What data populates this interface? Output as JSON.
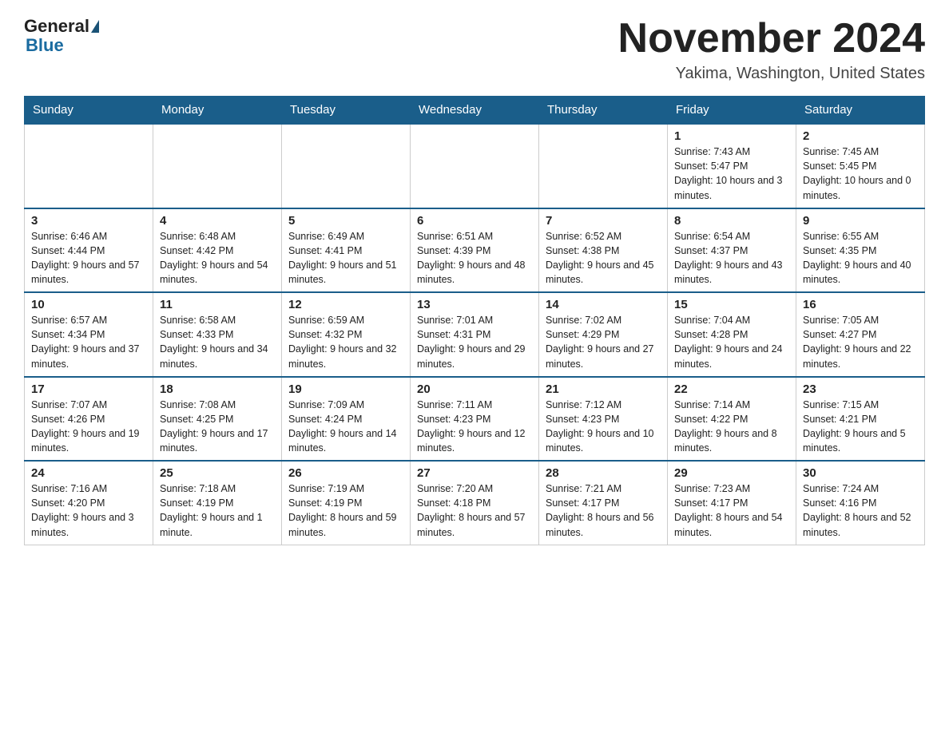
{
  "header": {
    "logo_general": "General",
    "logo_blue": "Blue",
    "month_title": "November 2024",
    "location": "Yakima, Washington, United States"
  },
  "weekdays": [
    "Sunday",
    "Monday",
    "Tuesday",
    "Wednesday",
    "Thursday",
    "Friday",
    "Saturday"
  ],
  "weeks": [
    [
      {
        "day": "",
        "info": "",
        "empty": true
      },
      {
        "day": "",
        "info": "",
        "empty": true
      },
      {
        "day": "",
        "info": "",
        "empty": true
      },
      {
        "day": "",
        "info": "",
        "empty": true
      },
      {
        "day": "",
        "info": "",
        "empty": true
      },
      {
        "day": "1",
        "info": "Sunrise: 7:43 AM\nSunset: 5:47 PM\nDaylight: 10 hours and 3 minutes."
      },
      {
        "day": "2",
        "info": "Sunrise: 7:45 AM\nSunset: 5:45 PM\nDaylight: 10 hours and 0 minutes."
      }
    ],
    [
      {
        "day": "3",
        "info": "Sunrise: 6:46 AM\nSunset: 4:44 PM\nDaylight: 9 hours and 57 minutes."
      },
      {
        "day": "4",
        "info": "Sunrise: 6:48 AM\nSunset: 4:42 PM\nDaylight: 9 hours and 54 minutes."
      },
      {
        "day": "5",
        "info": "Sunrise: 6:49 AM\nSunset: 4:41 PM\nDaylight: 9 hours and 51 minutes."
      },
      {
        "day": "6",
        "info": "Sunrise: 6:51 AM\nSunset: 4:39 PM\nDaylight: 9 hours and 48 minutes."
      },
      {
        "day": "7",
        "info": "Sunrise: 6:52 AM\nSunset: 4:38 PM\nDaylight: 9 hours and 45 minutes."
      },
      {
        "day": "8",
        "info": "Sunrise: 6:54 AM\nSunset: 4:37 PM\nDaylight: 9 hours and 43 minutes."
      },
      {
        "day": "9",
        "info": "Sunrise: 6:55 AM\nSunset: 4:35 PM\nDaylight: 9 hours and 40 minutes."
      }
    ],
    [
      {
        "day": "10",
        "info": "Sunrise: 6:57 AM\nSunset: 4:34 PM\nDaylight: 9 hours and 37 minutes."
      },
      {
        "day": "11",
        "info": "Sunrise: 6:58 AM\nSunset: 4:33 PM\nDaylight: 9 hours and 34 minutes."
      },
      {
        "day": "12",
        "info": "Sunrise: 6:59 AM\nSunset: 4:32 PM\nDaylight: 9 hours and 32 minutes."
      },
      {
        "day": "13",
        "info": "Sunrise: 7:01 AM\nSunset: 4:31 PM\nDaylight: 9 hours and 29 minutes."
      },
      {
        "day": "14",
        "info": "Sunrise: 7:02 AM\nSunset: 4:29 PM\nDaylight: 9 hours and 27 minutes."
      },
      {
        "day": "15",
        "info": "Sunrise: 7:04 AM\nSunset: 4:28 PM\nDaylight: 9 hours and 24 minutes."
      },
      {
        "day": "16",
        "info": "Sunrise: 7:05 AM\nSunset: 4:27 PM\nDaylight: 9 hours and 22 minutes."
      }
    ],
    [
      {
        "day": "17",
        "info": "Sunrise: 7:07 AM\nSunset: 4:26 PM\nDaylight: 9 hours and 19 minutes."
      },
      {
        "day": "18",
        "info": "Sunrise: 7:08 AM\nSunset: 4:25 PM\nDaylight: 9 hours and 17 minutes."
      },
      {
        "day": "19",
        "info": "Sunrise: 7:09 AM\nSunset: 4:24 PM\nDaylight: 9 hours and 14 minutes."
      },
      {
        "day": "20",
        "info": "Sunrise: 7:11 AM\nSunset: 4:23 PM\nDaylight: 9 hours and 12 minutes."
      },
      {
        "day": "21",
        "info": "Sunrise: 7:12 AM\nSunset: 4:23 PM\nDaylight: 9 hours and 10 minutes."
      },
      {
        "day": "22",
        "info": "Sunrise: 7:14 AM\nSunset: 4:22 PM\nDaylight: 9 hours and 8 minutes."
      },
      {
        "day": "23",
        "info": "Sunrise: 7:15 AM\nSunset: 4:21 PM\nDaylight: 9 hours and 5 minutes."
      }
    ],
    [
      {
        "day": "24",
        "info": "Sunrise: 7:16 AM\nSunset: 4:20 PM\nDaylight: 9 hours and 3 minutes."
      },
      {
        "day": "25",
        "info": "Sunrise: 7:18 AM\nSunset: 4:19 PM\nDaylight: 9 hours and 1 minute."
      },
      {
        "day": "26",
        "info": "Sunrise: 7:19 AM\nSunset: 4:19 PM\nDaylight: 8 hours and 59 minutes."
      },
      {
        "day": "27",
        "info": "Sunrise: 7:20 AM\nSunset: 4:18 PM\nDaylight: 8 hours and 57 minutes."
      },
      {
        "day": "28",
        "info": "Sunrise: 7:21 AM\nSunset: 4:17 PM\nDaylight: 8 hours and 56 minutes."
      },
      {
        "day": "29",
        "info": "Sunrise: 7:23 AM\nSunset: 4:17 PM\nDaylight: 8 hours and 54 minutes."
      },
      {
        "day": "30",
        "info": "Sunrise: 7:24 AM\nSunset: 4:16 PM\nDaylight: 8 hours and 52 minutes."
      }
    ]
  ]
}
